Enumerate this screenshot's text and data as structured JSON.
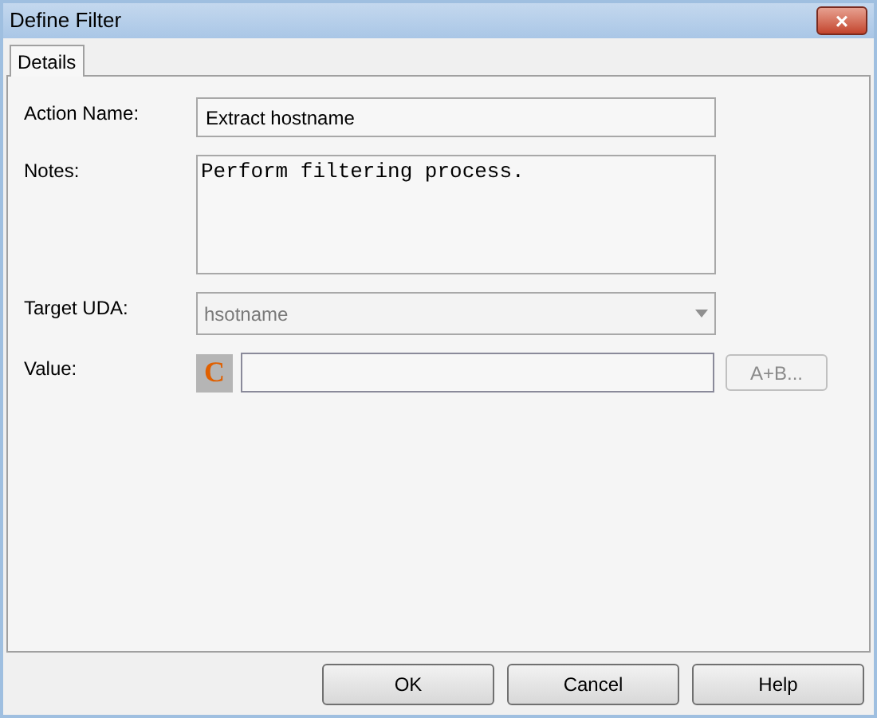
{
  "window": {
    "title": "Define Filter",
    "close": "×"
  },
  "tabs": [
    {
      "label": "Details",
      "selected": true
    }
  ],
  "form": {
    "action_name": {
      "label": "Action Name:",
      "value": "Extract hostname"
    },
    "notes": {
      "label": "Notes:",
      "value": "Perform filtering process."
    },
    "target_uda": {
      "label": "Target UDA:",
      "value": "hsotname",
      "disabled": true
    },
    "value": {
      "label": "Value:",
      "badge": "C",
      "expression_button": {
        "label": "A+B...",
        "disabled": true
      }
    }
  },
  "buttons": [
    {
      "label": "OK"
    },
    {
      "label": "Cancel"
    },
    {
      "label": "Help"
    }
  ]
}
